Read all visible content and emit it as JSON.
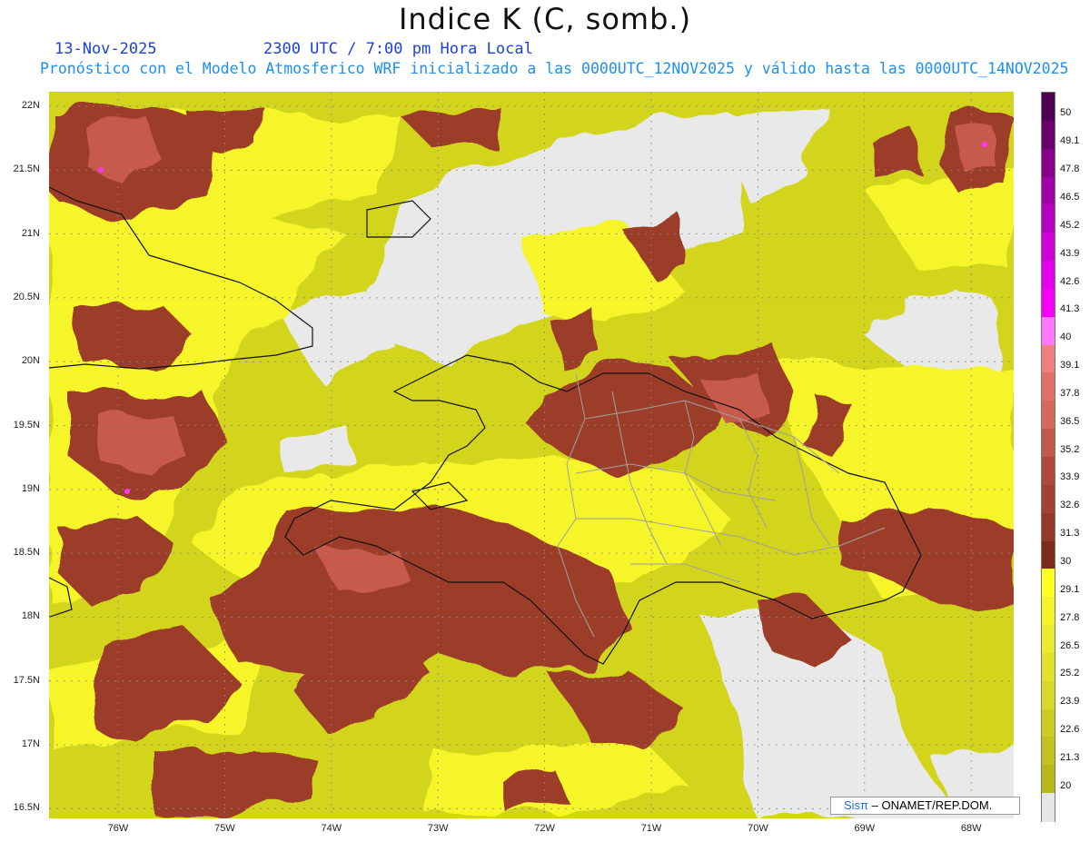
{
  "header": {
    "title": "Indice K (C, somb.)",
    "date": "13-Nov-2025",
    "time": "2300 UTC / 7:00 pm Hora Local",
    "subtitle": "Pronóstico con el Modelo Atmosferico WRF inicializado a las 0000UTC_12NOV2025 y válido hasta las  0000UTC_14NOV2025"
  },
  "map": {
    "lat_labels": [
      "22N",
      "21.5N",
      "21N",
      "20.5N",
      "20N",
      "19.5N",
      "19N",
      "18.5N",
      "18N",
      "17.5N",
      "17N",
      "16.5N"
    ],
    "lon_labels": [
      "76W",
      "75W",
      "74W",
      "73W",
      "72W",
      "71W",
      "70W",
      "69W",
      "68W"
    ],
    "colors": {
      "no_data": "#e9e9e9",
      "low": "#d3d51c",
      "mid": "#f5f52a",
      "high": "#9c3c2c",
      "high_light": "#c85a4c",
      "peak": "#ff33ff",
      "coast": "#111111",
      "borders": "#a0a0a0"
    }
  },
  "colorbar": {
    "labels": [
      "50",
      "49.1",
      "47.8",
      "46.5",
      "45.2",
      "43.9",
      "42.6",
      "41.3",
      "40",
      "39.1",
      "37.8",
      "36.5",
      "35.2",
      "33.9",
      "32.6",
      "31.3",
      "30",
      "29.1",
      "27.8",
      "26.5",
      "25.2",
      "23.9",
      "22.6",
      "21.3",
      "20"
    ],
    "colors": [
      "#500050",
      "#6a006a",
      "#86008a",
      "#a000a8",
      "#b800c0",
      "#d000d8",
      "#e300ea",
      "#f400f8",
      "#ff77ff",
      "#f08080",
      "#e07068",
      "#d46a5c",
      "#c25a4c",
      "#b04a3c",
      "#a24232",
      "#94382a",
      "#7e2a1c",
      "#ffff20",
      "#f4f42a",
      "#eaea30",
      "#e2e22c",
      "#d8d828",
      "#cccc22",
      "#c2c21e",
      "#b6b818",
      "#e6e6e6"
    ]
  },
  "credit": {
    "brand": "Sisπ",
    "text": "– ONAMET/REP.DOM."
  }
}
